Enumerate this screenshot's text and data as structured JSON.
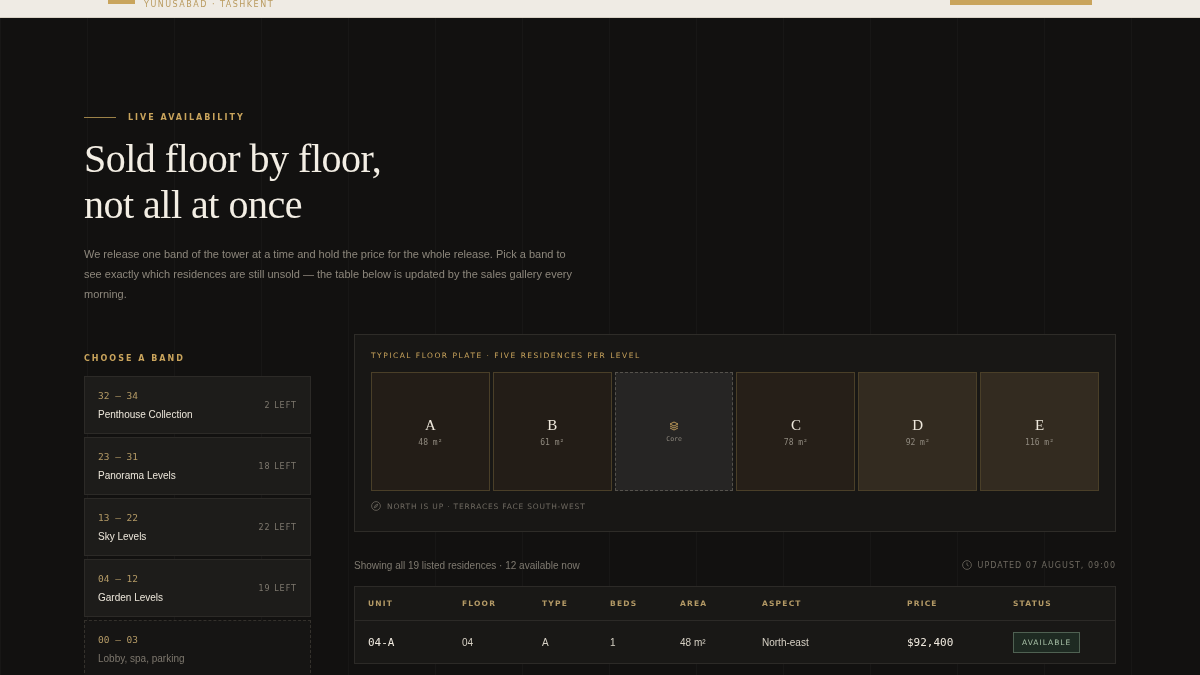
{
  "header": {
    "tagline": "YUNUSABAD · TASHKENT"
  },
  "hero": {
    "eyebrow": "LIVE AVAILABILITY",
    "title_lines": [
      "Sold floor by floor,",
      "not all at once"
    ],
    "intro": "We release one band of the tower at a time and hold the price for the whole release. Pick a band to see exactly which residences are still unsold — the table below is updated by the sales gallery every morning."
  },
  "bands": {
    "heading": "CHOOSE A BAND",
    "items": [
      {
        "range": "32 – 34",
        "name": "Penthouse Collection",
        "left": "2 LEFT",
        "disabled": false
      },
      {
        "range": "23 – 31",
        "name": "Panorama Levels",
        "left": "18 LEFT",
        "disabled": false
      },
      {
        "range": "13 – 22",
        "name": "Sky Levels",
        "left": "22 LEFT",
        "disabled": false
      },
      {
        "range": "04 – 12",
        "name": "Garden Levels",
        "left": "19 LEFT",
        "disabled": false
      },
      {
        "range": "00 – 03",
        "name": "Lobby, spa, parking",
        "disabled": true
      }
    ]
  },
  "floor_plate": {
    "title": "TYPICAL FLOOR PLATE · FIVE RESIDENCES PER LEVEL",
    "cells": [
      {
        "kind": "unit",
        "label": "A",
        "area": "48 m²",
        "color": "#231d17"
      },
      {
        "kind": "unit",
        "label": "B",
        "area": "61 m²",
        "color": "#231d17"
      },
      {
        "kind": "core",
        "label": "Core"
      },
      {
        "kind": "unit",
        "label": "C",
        "area": "78 m²",
        "color": "#261f18"
      },
      {
        "kind": "unit",
        "label": "D",
        "area": "92 m²",
        "color": "#332b20"
      },
      {
        "kind": "unit",
        "label": "E",
        "area": "116 m²",
        "color": "#332b20"
      }
    ],
    "note": "NORTH IS UP · TERRACES FACE SOUTH-WEST"
  },
  "listing": {
    "summary": "Showing all 19 listed residences · 12 available now",
    "updated": "UPDATED 07 AUGUST, 09:00",
    "columns": [
      "UNIT",
      "FLOOR",
      "TYPE",
      "BEDS",
      "AREA",
      "ASPECT",
      "PRICE",
      "STATUS"
    ],
    "rows": [
      {
        "unit": "04-A",
        "floor": "04",
        "type": "A",
        "beds": "1",
        "area": "48 m²",
        "aspect": "North-east",
        "price": "$92,400",
        "status": "AVAILABLE",
        "available": true
      }
    ]
  }
}
